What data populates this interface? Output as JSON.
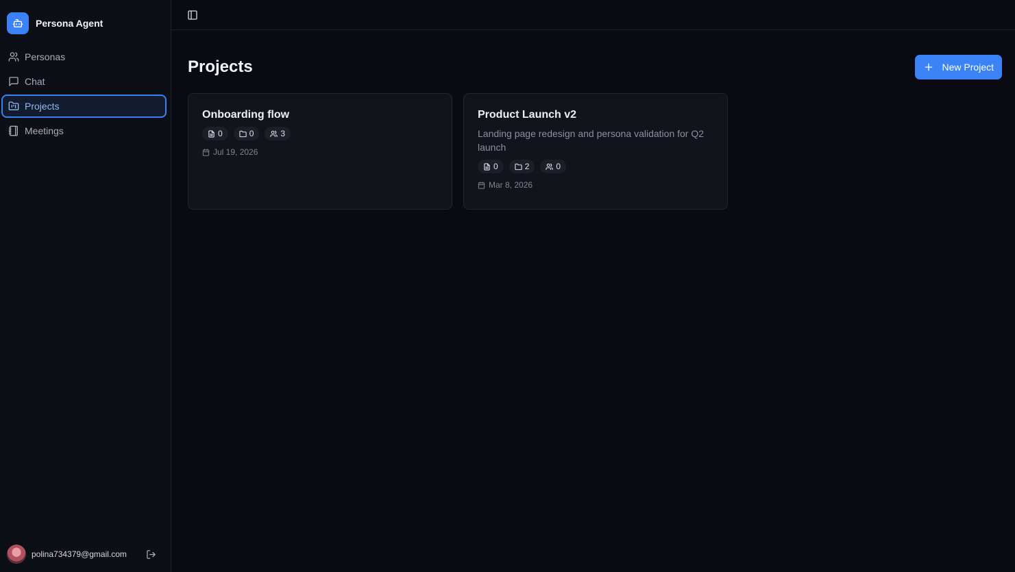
{
  "app": {
    "name": "Persona Agent",
    "accent": "#3b82f6"
  },
  "sidebar": {
    "items": [
      {
        "label": "Personas",
        "icon": "users-icon"
      },
      {
        "label": "Chat",
        "icon": "message-square-icon"
      },
      {
        "label": "Projects",
        "icon": "folder-kanban-icon",
        "active": true
      },
      {
        "label": "Meetings",
        "icon": "notebook-icon"
      }
    ]
  },
  "user": {
    "email": "polina734379@gmail.com"
  },
  "page": {
    "title": "Projects",
    "new_button": "New Project"
  },
  "projects": [
    {
      "title": "Onboarding flow",
      "description": "",
      "documents": "0",
      "folders": "0",
      "personas": "3",
      "date": "Jul 19, 2026"
    },
    {
      "title": "Product Launch v2",
      "description": "Landing page redesign and persona validation for Q2 launch",
      "documents": "0",
      "folders": "2",
      "personas": "0",
      "date": "Mar 8, 2026"
    }
  ]
}
